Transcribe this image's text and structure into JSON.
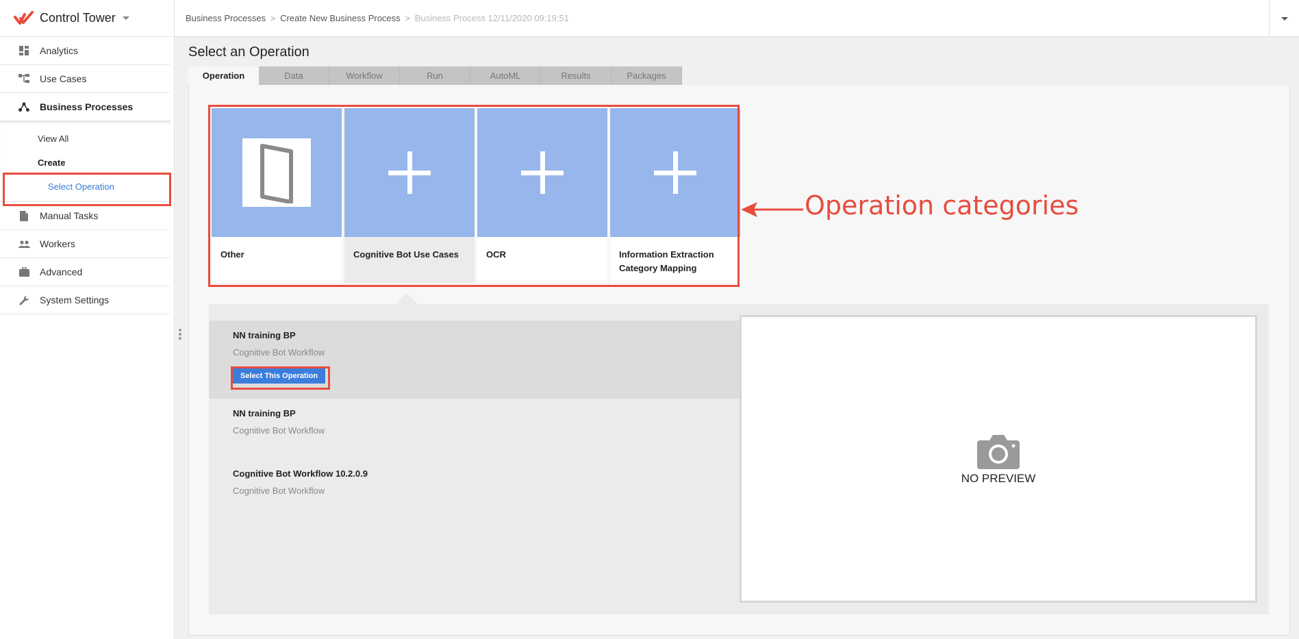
{
  "app": {
    "name": "Control Tower",
    "logo_color": "#e84c3d"
  },
  "sidebar": {
    "items": [
      {
        "label": "Analytics",
        "icon": "dashboard-icon"
      },
      {
        "label": "Use Cases",
        "icon": "hierarchy-icon"
      },
      {
        "label": "Business Processes",
        "icon": "share-nodes-icon",
        "active": true
      },
      {
        "label": "Manual Tasks",
        "icon": "document-icon"
      },
      {
        "label": "Workers",
        "icon": "people-icon"
      },
      {
        "label": "Advanced",
        "icon": "briefcase-icon"
      },
      {
        "label": "System Settings",
        "icon": "wrench-icon"
      }
    ],
    "submenu": {
      "view_all": "View All",
      "create": "Create",
      "select_operation": "Select Operation"
    }
  },
  "breadcrumb": {
    "items": [
      "Business Processes",
      "Create New Business Process",
      "Business Process 12/11/2020 09:19:51"
    ]
  },
  "page": {
    "title": "Select an Operation"
  },
  "tabs": [
    "Operation",
    "Data",
    "Workflow",
    "Run",
    "AutoML",
    "Results",
    "Packages"
  ],
  "categories": [
    {
      "label": "Other",
      "icon": "door-icon"
    },
    {
      "label": "Cognitive Bot Use Cases",
      "icon": "plus-icon"
    },
    {
      "label": "OCR",
      "icon": "plus-icon"
    },
    {
      "label": "Information Extraction Category Mapping",
      "icon": "plus-icon"
    }
  ],
  "annotation": {
    "label": "Operation categories",
    "color": "#e84c3d"
  },
  "operations": [
    {
      "name": "NN training BP",
      "type": "Cognitive Bot Workflow",
      "selected": true
    },
    {
      "name": "NN training BP",
      "type": "Cognitive Bot Workflow"
    },
    {
      "name": "Cognitive Bot Workflow 10.2.0.9",
      "type": "Cognitive Bot Workflow"
    }
  ],
  "select_button": {
    "label": "Select This Operation",
    "color": "#3b7ddd"
  },
  "preview": {
    "label": "NO PREVIEW",
    "icon": "camera-icon"
  }
}
